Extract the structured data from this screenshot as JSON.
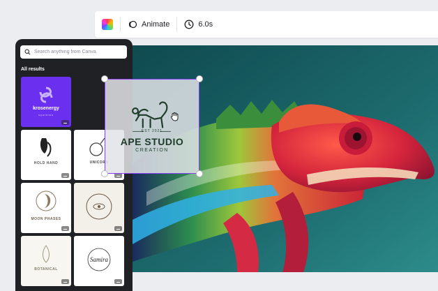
{
  "toolbar": {
    "color_icon": "color-palette-icon",
    "animate_label": "Animate",
    "duration_label": "6.0s"
  },
  "panel": {
    "search": {
      "placeholder": "Search anything from Canva",
      "value": ""
    },
    "section_title": "All results",
    "thumbnails": [
      {
        "title": "krosenergy",
        "subtitle": "systems"
      },
      {
        "title": "HOLD HAND"
      },
      {
        "title": "UNICORN"
      },
      {
        "title": "MOON PHASES"
      },
      {
        "title": ""
      },
      {
        "title": "BOTANICAL"
      },
      {
        "title": "Samira"
      }
    ]
  },
  "selected_logo": {
    "est": "EST 2021",
    "title": "APE STUDIO",
    "subtitle": "CREATION"
  },
  "colors": {
    "accent": "#8b3dff",
    "panel_bg": "#1f2125",
    "thumb_purple": "#6b2ff0",
    "logo_green": "#1e3b2a"
  }
}
